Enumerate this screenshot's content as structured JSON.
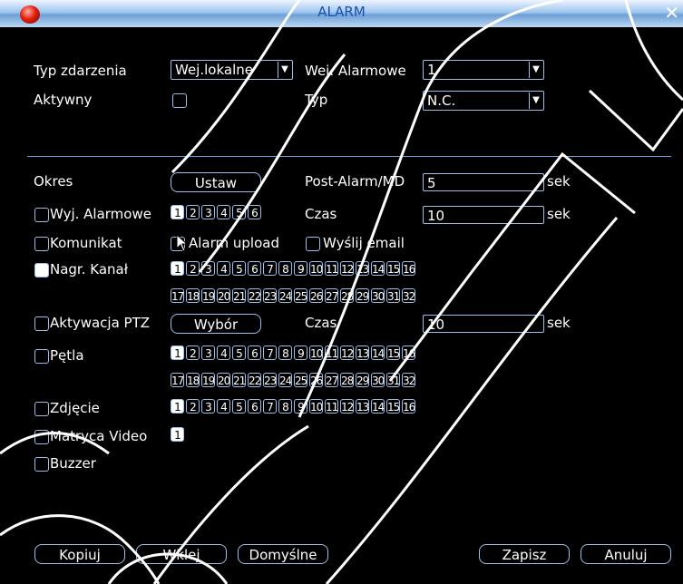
{
  "window": {
    "title": "ALARM",
    "close_glyph": "✕"
  },
  "fields": {
    "event_type_label": "Typ zdarzenia",
    "event_type_value": "Wej.lokalne",
    "alarm_input_label": "Wej. Alarmowe",
    "alarm_input_value": "1",
    "active_label": "Aktywny",
    "type_label": "Typ",
    "type_value": "N.C.",
    "period_label": "Okres",
    "set_button": "Ustaw",
    "post_alarm_label": "Post-Alarm/MD",
    "post_alarm_value": "5",
    "post_alarm_unit": "sek",
    "alarm_out_label": "Wyj. Alarmowe",
    "czas1_label": "Czas",
    "czas1_value": "10",
    "czas1_unit": "sek",
    "message_label": "Komunikat",
    "alarm_upload_label": "Alarm upload",
    "send_email_label": "Wyślij email",
    "record_channel_label": "Nagr. Kanał",
    "ptz_label": "Aktywacja PTZ",
    "select_button": "Wybór",
    "czas2_label": "Czas",
    "czas2_value": "10",
    "czas2_unit": "sek",
    "tour_label": "Pętla",
    "snapshot_label": "Zdjęcie",
    "video_matrix_label": "Matryca Video",
    "buzzer_label": "Buzzer"
  },
  "alarm_outputs": [
    "1",
    "2",
    "3",
    "4",
    "5",
    "6"
  ],
  "channels_row1": [
    "1",
    "2",
    "3",
    "4",
    "5",
    "6",
    "7",
    "8",
    "9",
    "10",
    "11",
    "12",
    "13",
    "14",
    "15",
    "16"
  ],
  "channels_row2": [
    "17",
    "18",
    "19",
    "20",
    "21",
    "22",
    "23",
    "24",
    "25",
    "26",
    "27",
    "28",
    "29",
    "30",
    "31",
    "32"
  ],
  "matrix_channels": [
    "1"
  ],
  "footer": {
    "copy": "Kopiuj",
    "paste": "Wklej",
    "default": "Domyślne",
    "save": "Zapisz",
    "cancel": "Anuluj"
  },
  "icons": {
    "app": "alarm-orb-icon",
    "cursor": "mouse-pointer-icon",
    "dropdown": "chevron-down-icon"
  },
  "colors": {
    "title_gradient_mid": "#9fc6ee",
    "border": "#9cc0ea",
    "title_text": "#1a4fb0"
  }
}
